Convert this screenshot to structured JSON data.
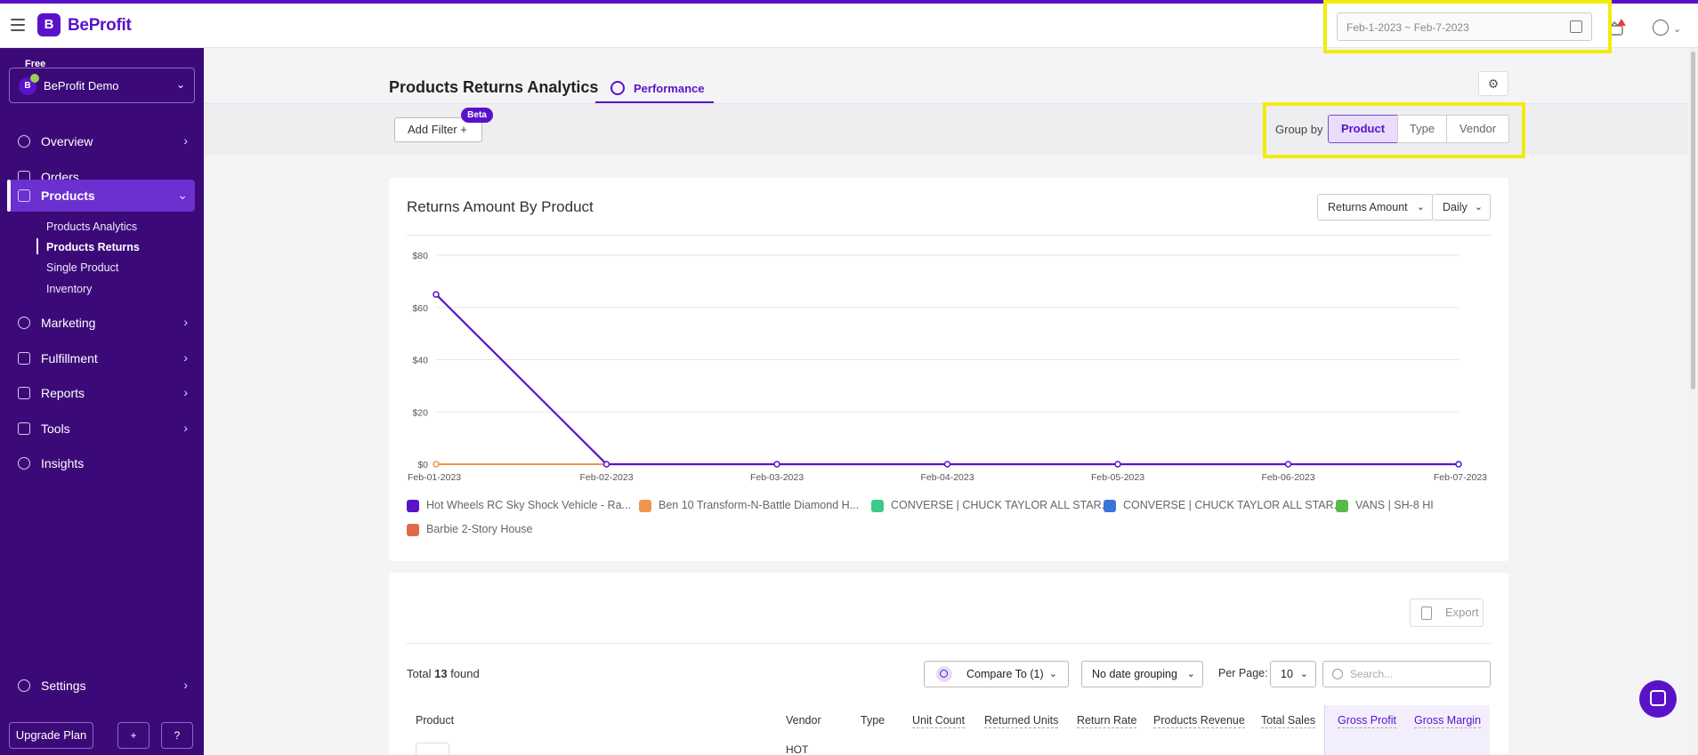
{
  "app": {
    "name": "BeProfit"
  },
  "header": {
    "date_range": "Feb-1-2023 ~ Feb-7-2023"
  },
  "sidebar": {
    "plan": "Free",
    "store": {
      "name": "BeProfit Demo",
      "avatar": "B"
    },
    "items": [
      {
        "label": "Overview",
        "icon": "gauge-icon"
      },
      {
        "label": "Orders",
        "icon": "cart-icon"
      },
      {
        "label": "Products",
        "icon": "bag-icon",
        "active": true
      },
      {
        "label": "Marketing",
        "icon": "target-icon"
      },
      {
        "label": "Fulfillment",
        "icon": "truck-icon"
      },
      {
        "label": "Reports",
        "icon": "bar-chart-icon"
      },
      {
        "label": "Tools",
        "icon": "tools-icon"
      },
      {
        "label": "Insights",
        "icon": "lightbulb-icon"
      }
    ],
    "sub_items": [
      {
        "label": "Products Analytics"
      },
      {
        "label": "Products Returns",
        "active": true
      },
      {
        "label": "Single Product"
      },
      {
        "label": "Inventory"
      }
    ],
    "settings": {
      "label": "Settings"
    },
    "upgrade": {
      "label": "Upgrade Plan"
    }
  },
  "page": {
    "title": "Products Returns Analytics",
    "tab": "Performance",
    "add_filter": "Add Filter",
    "beta": "Beta",
    "group_by": {
      "label": "Group by",
      "options": [
        "Product",
        "Type",
        "Vendor"
      ],
      "selected": "Product"
    }
  },
  "chart_card": {
    "title": "Returns Amount By Product",
    "metric_select": "Returns Amount",
    "interval_select": "Daily"
  },
  "chart_data": {
    "type": "line",
    "title": "Returns Amount By Product",
    "x": [
      "Feb-01-2023",
      "Feb-02-2023",
      "Feb-03-2023",
      "Feb-04-2023",
      "Feb-05-2023",
      "Feb-06-2023",
      "Feb-07-2023"
    ],
    "y_ticks": [
      "$0",
      "$20",
      "$40",
      "$60",
      "$80"
    ],
    "ylim": [
      0,
      80
    ],
    "grid": true,
    "legend_position": "bottom",
    "series": [
      {
        "name": "Hot Wheels RC Sky Shock Vehicle - Ra...",
        "color": "#5a12c9",
        "values": [
          65,
          0,
          0,
          0,
          0,
          0,
          0
        ]
      },
      {
        "name": "Ben 10 Transform-N-Battle Diamond H...",
        "color": "#f0964a",
        "values": [
          0,
          0,
          0,
          0,
          0,
          0,
          0
        ]
      },
      {
        "name": "CONVERSE | CHUCK TAYLOR ALL STAR...",
        "color": "#3cc98a",
        "values": [
          0,
          0,
          0,
          0,
          0,
          0,
          0
        ]
      },
      {
        "name": "CONVERSE | CHUCK TAYLOR ALL STAR...",
        "color": "#3b74d9",
        "values": [
          0,
          0,
          0,
          0,
          0,
          0,
          0
        ]
      },
      {
        "name": "VANS | SH-8 HI",
        "color": "#58b94a",
        "values": [
          0,
          0,
          0,
          0,
          0,
          0,
          0
        ]
      },
      {
        "name": "Barbie 2-Story House",
        "color": "#e0694a",
        "values": [
          0,
          0,
          0,
          0,
          0,
          0,
          0
        ]
      }
    ]
  },
  "table": {
    "export": "Export",
    "total_prefix": "Total",
    "total_count": "13",
    "total_suffix": "found",
    "compare": "Compare To (1)",
    "date_grouping": "No date grouping",
    "per_page_label": "Per Page:",
    "per_page": "10",
    "search_placeholder": "Search...",
    "columns": [
      "Product",
      "Vendor",
      "Type",
      "Unit Count",
      "Returned Units",
      "Return Rate",
      "Products Revenue",
      "Total Sales",
      "Gross Profit",
      "Gross Margin"
    ],
    "first_row_vendor": "HOT"
  }
}
